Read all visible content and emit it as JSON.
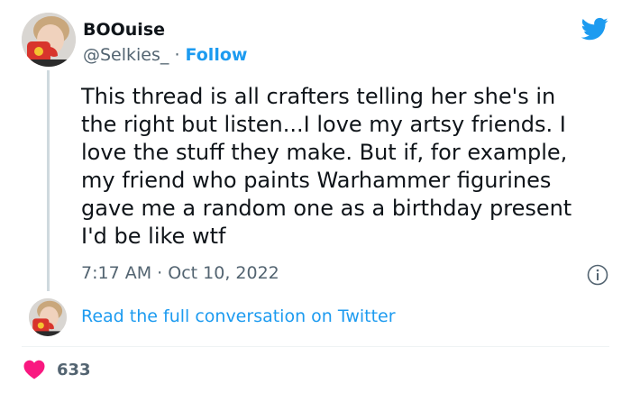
{
  "author": {
    "display_name": "BOOuise",
    "handle": "@Selkies_",
    "separator": "·",
    "follow_label": "Follow"
  },
  "tweet": {
    "lines": [
      "This thread is all crafters telling her she's in",
      "the right but listen...I love my artsy friends. I",
      "love the stuff they make. But if, for example,",
      "my friend who paints Warhammer figurines",
      "gave me a random one as a birthday present",
      "I'd be like wtf"
    ],
    "time": "7:17 AM",
    "separator": "·",
    "date": "Oct 10, 2022"
  },
  "conversation_link": "Read the full conversation on Twitter",
  "likes": {
    "count": "633"
  },
  "icons": {
    "brand": "twitter-bird-icon",
    "info": "info-icon",
    "like": "heart-icon"
  },
  "colors": {
    "accent": "#1d9bf0",
    "text": "#0f1419",
    "muted": "#536471",
    "heart": "#f91880",
    "thread_line": "#cfd9de"
  }
}
